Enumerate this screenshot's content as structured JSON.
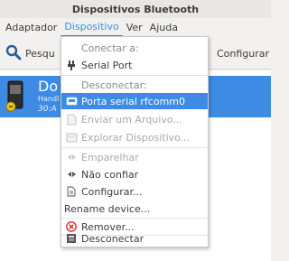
{
  "window": {
    "title": "Dispositivos Bluetooth"
  },
  "menubar": {
    "items": [
      {
        "label": "Adaptador"
      },
      {
        "label": "Dispositivo"
      },
      {
        "label": "Ver"
      },
      {
        "label": "Ajuda"
      }
    ]
  },
  "toolbar": {
    "search_label": "Pesqu",
    "configure_label": "Configurar"
  },
  "device": {
    "name": "Do",
    "subtitle1": "Handl",
    "subtitle2": "30:A"
  },
  "menu": {
    "connect_header": "Conectar a:",
    "serial_port": "Serial Port",
    "disconnect_header": "Desconectar:",
    "porta_serial": "Porta serial rfcomm0",
    "enviar": "Enviar um Arquivo...",
    "explorar": "Explorar Dispositivo...",
    "emparelhar": "Emparelhar",
    "nao_confiar": "Não confiar",
    "configurar": "Configurar...",
    "rename": "Rename device...",
    "remover": "Remover...",
    "desconectar": "Desconectar"
  },
  "colors": {
    "accent": "#3d8be4",
    "remove": "#d9302c"
  }
}
